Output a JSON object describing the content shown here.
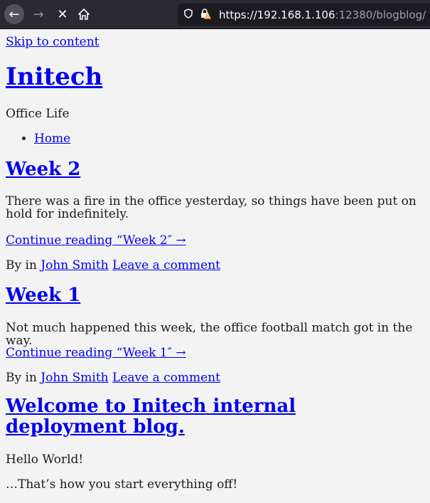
{
  "browser": {
    "url_host": "https://192.168.1.106",
    "url_rest": ":12380/blogblog/"
  },
  "site": {
    "skip_link": "Skip to content",
    "title": "Initech",
    "tagline": "Office Life",
    "nav": [
      "Home"
    ]
  },
  "posts": [
    {
      "title": "Week 2",
      "excerpt": "There was a fire in the office yesterday, so things have been put on hold for  indefinitely.",
      "continue": "Continue reading “Week 2″ →",
      "by": "By in",
      "author": "John Smith",
      "comment": "Leave a comment"
    },
    {
      "title": "Week 1",
      "excerpt": "Not much happened this week, the office football match got in the way.",
      "continue": "Continue reading “Week 1″ →",
      "by": "By in",
      "author": "John Smith",
      "comment": "Leave a comment"
    },
    {
      "title": "Welcome to Initech internal deployment blog.",
      "lines": [
        "Hello World!",
        "…That’s how you start everything off!"
      ]
    }
  ]
}
